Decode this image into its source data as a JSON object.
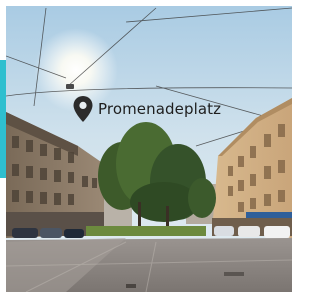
{
  "location": {
    "name": "Promenadeplatz",
    "icon": "map-pin-icon"
  },
  "colors": {
    "accent": "#2fbfcf",
    "pin": "#2b2b2b"
  }
}
